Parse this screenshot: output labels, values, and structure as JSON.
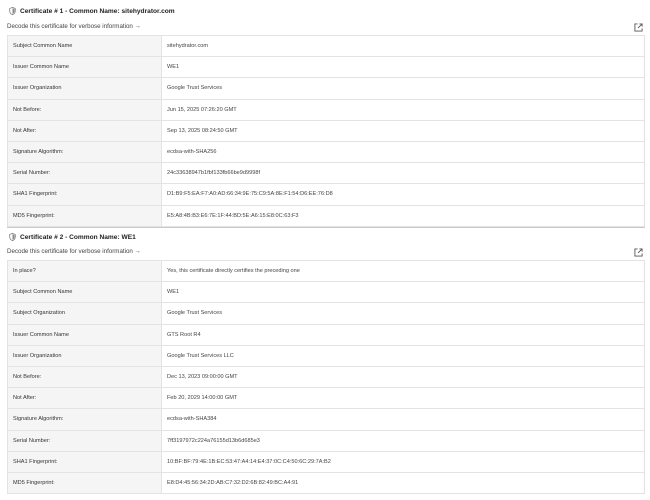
{
  "certificates": [
    {
      "title": "Certificate # 1 - Common Name: sitehydrator.com",
      "decode_link": "Decode this certificate for verbose information →",
      "rows": [
        {
          "label": "Subject Common Name",
          "value": "sitehydrator.com"
        },
        {
          "label": "Issuer Common Name",
          "value": "WE1"
        },
        {
          "label": "Issuer Organization",
          "value": "Google Trust Services"
        },
        {
          "label": "Not Before:",
          "value": "Jun 15, 2025 07:26:20 GMT"
        },
        {
          "label": "Not After:",
          "value": "Sep 13, 2025 08:24:50 GMT"
        },
        {
          "label": "Signature Algorithm:",
          "value": "ecdsa-with-SHA256"
        },
        {
          "label": "Serial Number:",
          "value": "24c33638947b1fbf133fb66be9d9998f"
        },
        {
          "label": "SHA1 Fingerprint:",
          "value": "D1:B9:F5:EA:F7:A0:AD:66:34:9E:75:C9:5A:8E:F1:54:D6:EE:76:D8"
        },
        {
          "label": "MD5 Fingerprint:",
          "value": "E5:A8:4B:B3:E6:7E:1F:44:BD:5E:A6:15:E8:0C:63:F3"
        }
      ]
    },
    {
      "title": "Certificate # 2 - Common Name: WE1",
      "decode_link": "Decode this certificate for verbose information →",
      "rows": [
        {
          "label": "In place?",
          "value": "Yes, this certificate directly certifies the preceding one"
        },
        {
          "label": "Subject Common Name",
          "value": "WE1"
        },
        {
          "label": "Subject Organization",
          "value": "Google Trust Services"
        },
        {
          "label": "Issuer Common Name",
          "value": "GTS Root R4"
        },
        {
          "label": "Issuer Organization",
          "value": "Google Trust Services LLC"
        },
        {
          "label": "Not Before:",
          "value": "Dec 13, 2023 09:00:00 GMT"
        },
        {
          "label": "Not After:",
          "value": "Feb 20, 2029 14:00:00 GMT"
        },
        {
          "label": "Signature Algorithm:",
          "value": "ecdsa-with-SHA384"
        },
        {
          "label": "Serial Number:",
          "value": "7ff3197972c224a76155d13b6d685e3"
        },
        {
          "label": "SHA1 Fingerprint:",
          "value": "10:BF:BF:79:4E:1B:EC:53:47:A4:14:E4:37:0C:C4:50:6C:29:7A:B2"
        },
        {
          "label": "MD5 Fingerprint:",
          "value": "E8:D4:45:56:34:2D:AB:C7:32:D2:6B:82:49:BC:A4:91"
        }
      ]
    }
  ],
  "icons": {
    "cert_header_icon": "shield-icon",
    "open_external_icon": "external-link-icon"
  }
}
